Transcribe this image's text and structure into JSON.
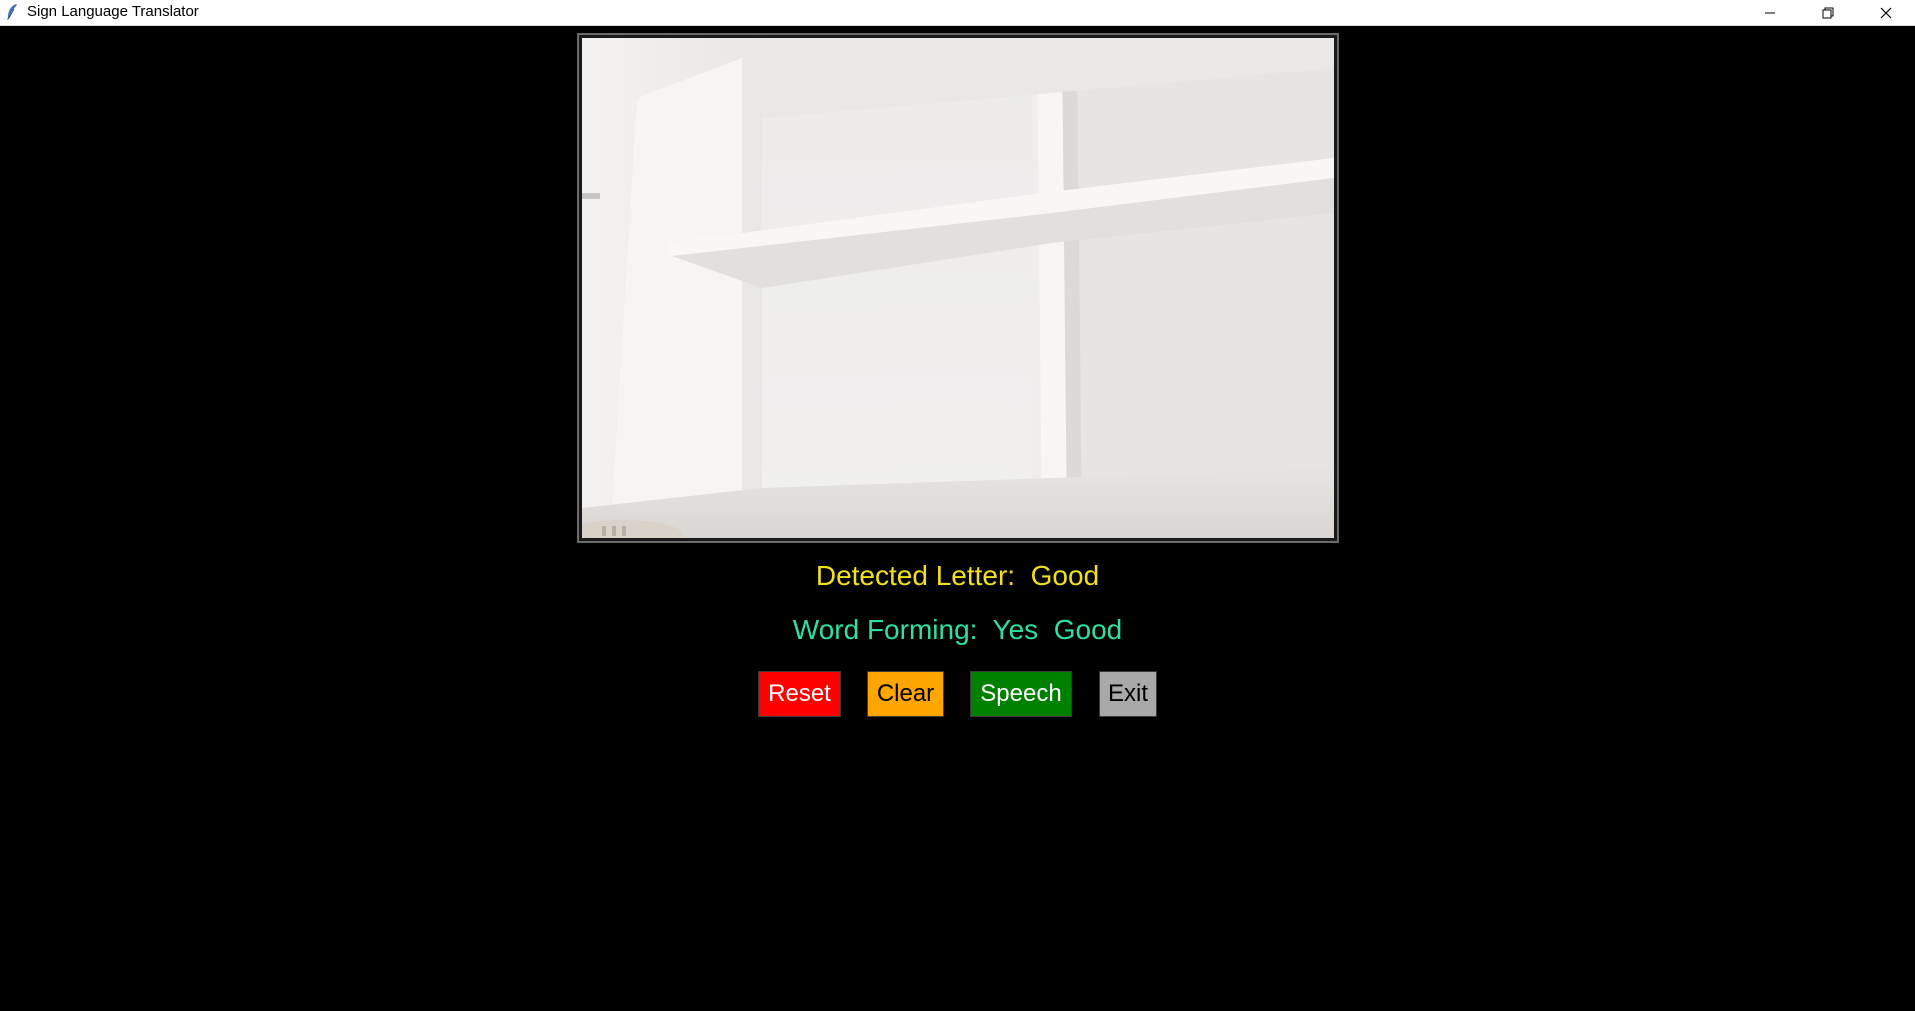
{
  "window": {
    "title": "Sign Language Translator",
    "controls": {
      "minimize_icon": "minimize-icon",
      "maximize_icon": "restore-icon",
      "close_icon": "close-icon"
    }
  },
  "detected": {
    "label": "Detected Letter:",
    "value": "Good",
    "color": "#f2e01a"
  },
  "word": {
    "label": "Word Forming:",
    "value": "Yes  Good",
    "color": "#2fe0a0"
  },
  "buttons": {
    "reset": {
      "label": "Reset",
      "color": "#ff0000"
    },
    "clear": {
      "label": "Clear",
      "color": "#ffa500"
    },
    "speech": {
      "label": "Speech",
      "color": "#008000"
    },
    "exit": {
      "label": "Exit",
      "color": "#a9a9a9"
    }
  }
}
